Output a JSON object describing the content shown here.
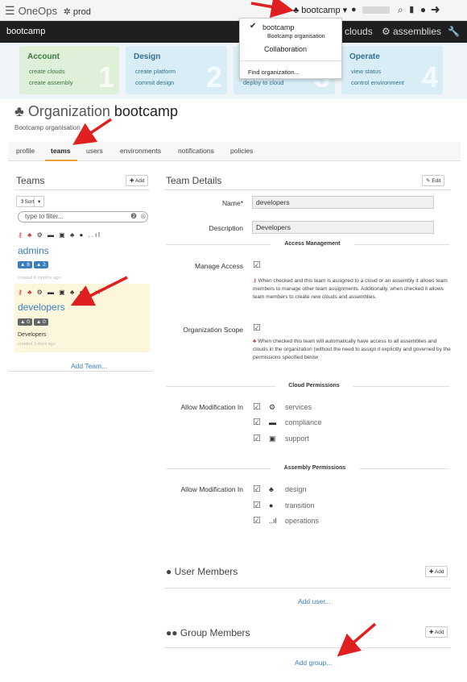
{
  "topbar": {
    "brand": "OneOps",
    "env": "prod",
    "org_selector": "bootcamp ▾"
  },
  "header": {
    "title": "bootcamp",
    "nav_clouds": "clouds",
    "nav_assemblies": "assemblies"
  },
  "dropdown": {
    "items": [
      "bootcamp",
      "Bootcamp organisation",
      "Collaboration"
    ],
    "find": "Find organization..."
  },
  "cards": [
    {
      "title": "Account",
      "links": [
        "create clouds",
        "create assembly"
      ],
      "number": "1",
      "color": "#dff0d8",
      "title_color": "#3c763d"
    },
    {
      "title": "Design",
      "links": [
        "create platform",
        "commit design"
      ],
      "number": "2",
      "color": "#d9edf7",
      "title_color": "#31708f"
    },
    {
      "title": "",
      "links": [
        "deploy to cloud"
      ],
      "number": "3",
      "color": "#d9edf7",
      "title_color": "#31708f"
    },
    {
      "title": "Operate",
      "links": [
        "view status",
        "control environment"
      ],
      "number": "4",
      "color": "#d9edf7",
      "title_color": "#31708f"
    }
  ],
  "org": {
    "prefix": "Organization",
    "name": "bootcamp",
    "description": "Bootcamp organisation"
  },
  "tabs": [
    "profile",
    "teams",
    "users",
    "environments",
    "notifications",
    "policies"
  ],
  "teams_panel": {
    "title": "Teams",
    "add_button": "✚ Add",
    "sort_button": "⇕Sort",
    "filter_placeholder": "type to filter...",
    "add_team": "Add Team...",
    "teams": [
      {
        "name": "admins",
        "badge1": "8",
        "badge2": "2",
        "meta": "created 8 months ago",
        "description": ""
      },
      {
        "name": "developers",
        "badge1": "0",
        "badge2": "0",
        "meta": "created 3 days ago",
        "description": "Developers"
      }
    ]
  },
  "details": {
    "title": "Team Details",
    "edit": "✎ Edit",
    "name_label": "Name*",
    "name_value": "developers",
    "desc_label": "Description",
    "desc_value": "Developers",
    "access_section": "Access Management",
    "manage_label": "Manage Access",
    "manage_desc": "When checked and this team is assigned to a cloud or an assembly it allows team members to manage other team assignments. Additionally, when checked it allows team members to create new clouds and assemblies.",
    "scope_label": "Organization Scope",
    "scope_desc": "When checked this team will automatically have access to all assemblies and clouds in the organization (without the need to assign it explicitly and governed by the permissions specified below",
    "cloud_section": "Cloud Permissions",
    "allow_label": "Allow Modification In",
    "cloud_perms": [
      "services",
      "compliance",
      "support"
    ],
    "assembly_section": "Assembly Permissions",
    "assembly_perms": [
      "design",
      "transition",
      "operations"
    ]
  },
  "members": {
    "user_title": "User Members",
    "add": "✚ Add",
    "add_user": "Add user...",
    "group_title": "Group Members",
    "add_group": "Add group..."
  }
}
